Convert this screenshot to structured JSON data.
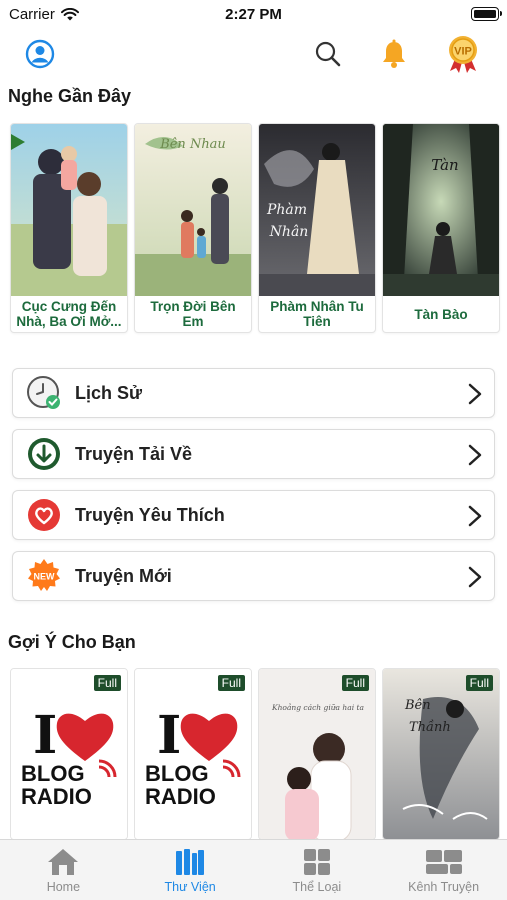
{
  "status_bar": {
    "carrier": "Carrier",
    "time": "2:27 PM"
  },
  "header": {
    "icons": [
      "user-profile-icon",
      "search-icon",
      "bell-icon",
      "vip-badge-icon"
    ]
  },
  "recent": {
    "title": "Nghe Gần Đây",
    "books": [
      {
        "title": "Cục Cưng Đến Nhà, Ba Ơi Mở..."
      },
      {
        "title": "Trọn Đời Bên Em"
      },
      {
        "title": "Phàm Nhân Tu Tiên"
      },
      {
        "title": "Tàn Bào"
      }
    ]
  },
  "menu": {
    "items": [
      {
        "label": "Lịch Sử",
        "icon": "history-clock-icon"
      },
      {
        "label": "Truyện Tải Về",
        "icon": "download-icon"
      },
      {
        "label": "Truyện Yêu Thích",
        "icon": "heart-icon"
      },
      {
        "label": "Truyện Mới",
        "icon": "new-badge-icon"
      }
    ]
  },
  "suggest": {
    "title": "Gợi Ý Cho Bạn",
    "badge": "Full",
    "cards": [
      {
        "logo_top": "I",
        "logo_blog": "BLOG",
        "logo_radio": "RADIO"
      },
      {
        "logo_top": "I",
        "logo_blog": "BLOG",
        "logo_radio": "RADIO"
      },
      {
        "caption": "Khoảng cách giữa hai ta"
      },
      {
        "caption": ""
      }
    ]
  },
  "tabs": [
    {
      "label": "Home",
      "active": false
    },
    {
      "label": "Thư Viện",
      "active": true
    },
    {
      "label": "Thể Loại",
      "active": false
    },
    {
      "label": "Kênh Truyện",
      "active": false
    }
  ],
  "colors": {
    "accent": "#1e88e5",
    "book_title": "#1d6b3d",
    "full_badge": "#1e4d2b",
    "bell": "#f5a623"
  }
}
